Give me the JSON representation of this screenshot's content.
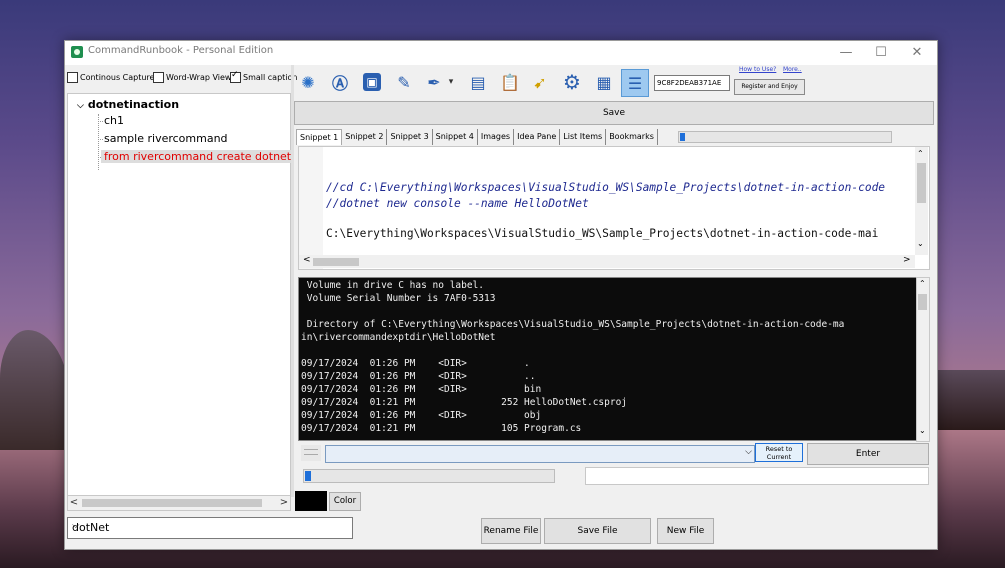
{
  "window": {
    "title": "CommandRunbook - Personal Edition",
    "minimize": "—",
    "maximize": "☐",
    "close": "✕"
  },
  "options": {
    "continuous_capture": "Continous Capture",
    "word_wrap_view": "Word-Wrap View",
    "small_caption": "Small caption",
    "small_caption_checked": true
  },
  "tree": {
    "root": "dotnetinaction",
    "items": [
      "ch1",
      "sample rivercommand",
      "from rivercommand create dotnet p"
    ]
  },
  "toolbar": {
    "icons": [
      "magic-wand-icon",
      "text-a-icon",
      "window-icon",
      "edit-icon",
      "dropper-icon",
      "panel-icon",
      "clipboard-icon",
      "run-icon",
      "gear-icon",
      "calendar-icon",
      "stack-icon"
    ],
    "key": "9C8F2DEAB371AE",
    "how_to_use": "How to Use?",
    "more": "More..",
    "register": "Register and Enjoy"
  },
  "save_label": "Save",
  "tabs": [
    "Snippet 1",
    "Snippet 2",
    "Snippet 3",
    "Snippet 4",
    "Images",
    "Idea Pane",
    "List Items",
    "Bookmarks"
  ],
  "tab_progress": 0.02,
  "editor": {
    "line1": "//cd C:\\Everything\\Workspaces\\VisualStudio_WS\\Sample_Projects\\dotnet-in-action-code",
    "line2": "//dotnet new console --name HelloDotNet",
    "line3": "C:\\Everything\\Workspaces\\VisualStudio_WS\\Sample_Projects\\dotnet-in-action-code-mai"
  },
  "terminal": {
    "lines": [
      " Volume in drive C has no label.",
      " Volume Serial Number is 7AF0-5313",
      "",
      " Directory of C:\\Everything\\Workspaces\\VisualStudio_WS\\Sample_Projects\\dotnet-in-action-code-ma",
      "in\\rivercommandexptdir\\HelloDotNet",
      "",
      "09/17/2024  01:26 PM    <DIR>          .",
      "09/17/2024  01:26 PM    <DIR>          ..",
      "09/17/2024  01:26 PM    <DIR>          bin",
      "09/17/2024  01:21 PM               252 HelloDotNet.csproj",
      "09/17/2024  01:26 PM    <DIR>          obj",
      "09/17/2024  01:21 PM               105 Program.cs"
    ]
  },
  "command": {
    "reset_label": "Reset to Current",
    "enter_label": "Enter"
  },
  "progress2": 0.02,
  "color_label": "Color",
  "bottom": {
    "profile": "dotNet",
    "rename": "Rename File",
    "save_file": "Save File",
    "new_file": "New File"
  }
}
